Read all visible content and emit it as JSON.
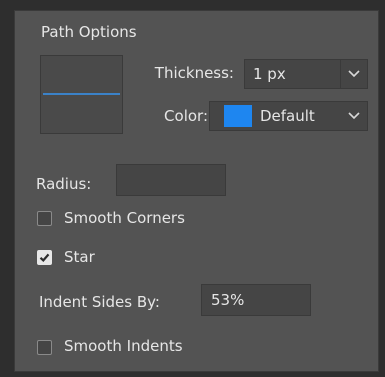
{
  "path_options": {
    "title": "Path Options",
    "thickness": {
      "label": "Thickness:",
      "value": "1 px"
    },
    "color": {
      "label": "Color:",
      "value": "Default",
      "swatch": "#1e86f0"
    },
    "preview_line_color": "#3b82c8",
    "radius": {
      "label": "Radius:",
      "value": ""
    },
    "smooth_corners": {
      "label": "Smooth Corners",
      "checked": false
    },
    "star": {
      "label": "Star",
      "checked": true
    },
    "indent_sides_by": {
      "label": "Indent Sides By:",
      "value": "53%"
    },
    "smooth_indents": {
      "label": "Smooth Indents",
      "checked": false
    }
  }
}
